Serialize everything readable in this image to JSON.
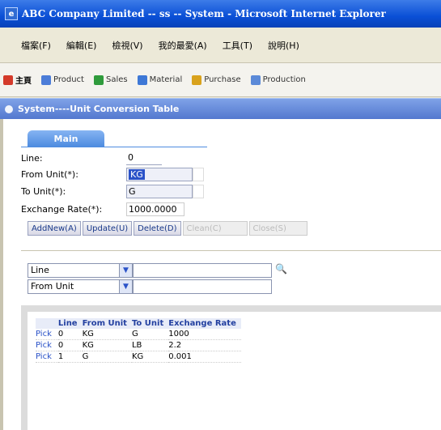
{
  "window": {
    "title": "ABC Company Limited -- ss -- System - Microsoft Internet Explorer"
  },
  "menu": {
    "items": [
      "檔案(F)",
      "編輯(E)",
      "檢視(V)",
      "我的最愛(A)",
      "工具(T)",
      "說明(H)"
    ]
  },
  "nav": {
    "tabs": [
      {
        "label": "主頁",
        "color": "#d43a2a"
      },
      {
        "label": "Product",
        "color": "#4c7dd8"
      },
      {
        "label": "Sales",
        "color": "#2f9b3b"
      },
      {
        "label": "Material",
        "color": "#3e78d6"
      },
      {
        "label": "Purchase",
        "color": "#d9a21c"
      },
      {
        "label": "Production",
        "color": "#5b8ad8"
      }
    ]
  },
  "panel": {
    "title": "System----Unit Conversion Table"
  },
  "form": {
    "main_tab": "Main",
    "line_label": "Line:",
    "line_value": "0",
    "from_unit_label": "From Unit(*):",
    "from_unit_value": "KG",
    "to_unit_label": "To Unit(*):",
    "to_unit_value": "G",
    "rate_label": "Exchange Rate(*):",
    "rate_value": "1000.0000"
  },
  "buttons": {
    "addnew": "AddNew(A)",
    "update": "Update(U)",
    "delete": "Delete(D)",
    "disabled1": "Clean(C)",
    "disabled2": "Close(S)"
  },
  "filters": [
    {
      "field": "Line"
    },
    {
      "field": "From Unit"
    }
  ],
  "grid": {
    "columns": [
      "",
      "Line",
      "From Unit",
      "To Unit",
      "Exchange Rate"
    ],
    "rows": [
      {
        "pick": "Pick",
        "line": "0",
        "from": "KG",
        "to": "G",
        "rate": "1000"
      },
      {
        "pick": "Pick",
        "line": "0",
        "from": "KG",
        "to": "LB",
        "rate": "2.2"
      },
      {
        "pick": "Pick",
        "line": "1",
        "from": "G",
        "to": "KG",
        "rate": "0.001"
      }
    ]
  },
  "colors": {
    "accent": "#2a52c8",
    "titlebar": "#0a4fd6",
    "panelbar": "#5378cf"
  }
}
